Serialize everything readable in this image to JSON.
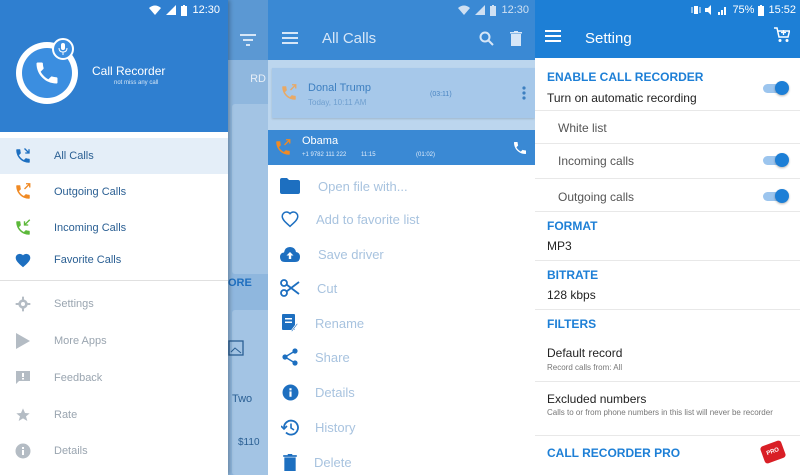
{
  "panel1": {
    "status_time": "12:30",
    "app_name": "Call Recorder",
    "tagline": "not miss any call",
    "bg_tab_label": "RD",
    "bg_more_label": "ORE",
    "bg_two": "Two",
    "bg_price": "$110",
    "items": [
      {
        "label": "All Calls",
        "icon": "all-calls-icon"
      },
      {
        "label": "Outgoing Calls",
        "icon": "outgoing-call-icon"
      },
      {
        "label": "Incoming Calls",
        "icon": "incoming-call-icon"
      },
      {
        "label": "Favorite Calls",
        "icon": "heart-icon"
      },
      {
        "label": "Settings",
        "icon": "gear-icon"
      },
      {
        "label": "More Apps",
        "icon": "play-store-icon"
      },
      {
        "label": "Feedback",
        "icon": "feedback-icon"
      },
      {
        "label": "Rate",
        "icon": "star-icon"
      },
      {
        "label": "Details",
        "icon": "info-icon"
      }
    ]
  },
  "panel2": {
    "status_time": "12:30",
    "title": "All Calls",
    "calls": [
      {
        "name": "Donal Trump",
        "time": "Today, 10:11 AM",
        "duration": "(03:11)"
      },
      {
        "name": "Obama",
        "number": "+1 9782 111 222",
        "time": "11:15",
        "duration": "(01:02)"
      }
    ],
    "actions": [
      {
        "label": "Open file with...",
        "icon": "folder-icon"
      },
      {
        "label": "Add to favorite list",
        "icon": "heart-outline-icon"
      },
      {
        "label": "Save driver",
        "icon": "cloud-upload-icon"
      },
      {
        "label": "Cut",
        "icon": "scissors-icon"
      },
      {
        "label": "Rename",
        "icon": "rename-icon"
      },
      {
        "label": "Share",
        "icon": "share-icon"
      },
      {
        "label": "Details",
        "icon": "info-icon"
      },
      {
        "label": "History",
        "icon": "history-icon"
      },
      {
        "label": "Delete",
        "icon": "trash-icon"
      }
    ]
  },
  "panel3": {
    "status_time": "15:52",
    "status_battery": "75%",
    "title": "Setting",
    "enable_header": "ENABLE CALL RECORDER",
    "auto_record": "Turn on automatic recording",
    "white_list": "White list",
    "incoming": "Incoming calls",
    "outgoing": "Outgoing calls",
    "format_header": "FORMAT",
    "format_value": "MP3",
    "bitrate_header": "BITRATE",
    "bitrate_value": "128 kbps",
    "filters_header": "FILTERS",
    "default_record": "Default record",
    "default_record_sub": "Record calls from: All",
    "excluded": "Excluded numbers",
    "excluded_sub": "Calls to or from phone numbers in this list will never be recorder",
    "pro_header": "CALL RECORDER PRO",
    "pro_badge": "PRO",
    "toggles": {
      "auto_record": true,
      "incoming": true,
      "outgoing": true
    }
  }
}
